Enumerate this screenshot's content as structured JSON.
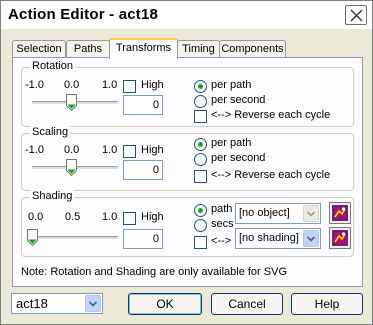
{
  "window": {
    "title": "Action Editor - act18"
  },
  "tabs": [
    "Selection",
    "Paths",
    "Transforms",
    "Timing",
    "Components"
  ],
  "active_tab": "Transforms",
  "rotation": {
    "legend": "Rotation",
    "scale_labels": [
      "-1.0",
      "0.0",
      "1.0"
    ],
    "high_label": "High",
    "value": "0",
    "slider_value": 0.0,
    "radio_labels": [
      "per path",
      "per second"
    ],
    "selected_radio": "per path",
    "reverse_label": "<--> Reverse each cycle"
  },
  "scaling": {
    "legend": "Scaling",
    "scale_labels": [
      "-1.0",
      "0.0",
      "1.0"
    ],
    "high_label": "High",
    "value": "0",
    "slider_value": 0.0,
    "radio_labels": [
      "per path",
      "per second"
    ],
    "selected_radio": "per path",
    "reverse_label": "<--> Reverse each cycle"
  },
  "shading": {
    "legend": "Shading",
    "scale_labels": [
      "0.0",
      "0.5",
      "1.0"
    ],
    "high_label": "High",
    "value": "0",
    "slider_value": 0.0,
    "radio_labels": [
      "path",
      "secs"
    ],
    "selected_radio": "path",
    "reverse_label": "<-->",
    "object_select": "[no object]",
    "shading_select": "[no shading]"
  },
  "note": "Note: Rotation and Shading are only available for SVG",
  "footer": {
    "action_select": "act18",
    "ok_label": "OK",
    "cancel_label": "Cancel",
    "help_label": "Help"
  },
  "colors": {
    "radio_dot": "#21a121",
    "slider_thumb": "#21a121",
    "active_tab_accent": "#ffc83c"
  }
}
